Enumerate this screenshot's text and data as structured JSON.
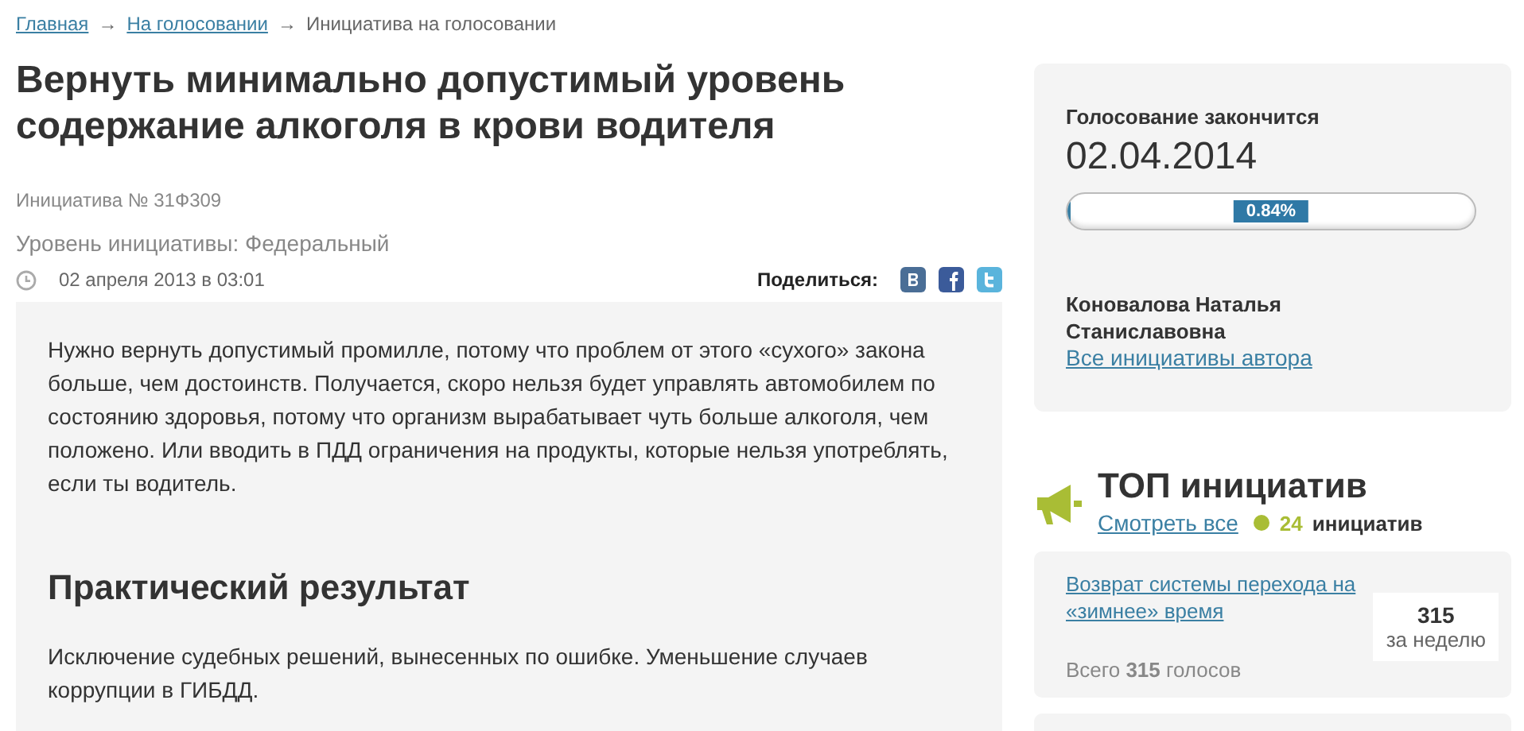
{
  "breadcrumbs": [
    {
      "label": "Главная",
      "kind": "link"
    },
    {
      "label": "На голосовании",
      "kind": "link"
    },
    {
      "label": "Инициатива на голосовании",
      "kind": "current"
    }
  ],
  "breadcrumb_separator": "→",
  "title": "Вернуть минимально допустимый уровень содержание алкоголя в крови водителя",
  "initiative_number": "Инициатива № 31Ф309",
  "level_text": "Уровень инициативы: Федеральный",
  "date": "02 апреля 2013 в 03:01",
  "share_label": "Поделиться:",
  "body": {
    "paragraphs": [
      "Нужно вернуть допустимый промилле, потому что проблем от этого «сухого» закона больше, чем достоинств. Получается, скоро нельзя будет управлять автомобилем по состоянию здоровья, потому что организм вырабатывает чуть больше алкоголя, чем положено. Или вводить в ПДД ограничения на продукты, которые нельзя употреблять, если ты водитель."
    ],
    "heading": "Практический результат",
    "result": "Исключение судебных решений, вынесенных по ошибке. Уменьшение случаев коррупции в ГИБДД."
  },
  "voting": {
    "label": "Голосование закончится",
    "end_date": "02.04.2014",
    "level": 0.0084,
    "percent": "0.84%",
    "author": "Коновалова Наталья Станиславовна",
    "author_link": "Все инициативы автора"
  },
  "top": {
    "title": "ТОП инициатив",
    "see_all": "Смотреть все",
    "count": "24",
    "count_word": "инициатив",
    "items": [
      {
        "title": "Возврат системы перехода на «зимнее» время",
        "total": "Всего **315** голосов",
        "week_count": "315",
        "week_label": "за неделю"
      }
    ]
  }
}
